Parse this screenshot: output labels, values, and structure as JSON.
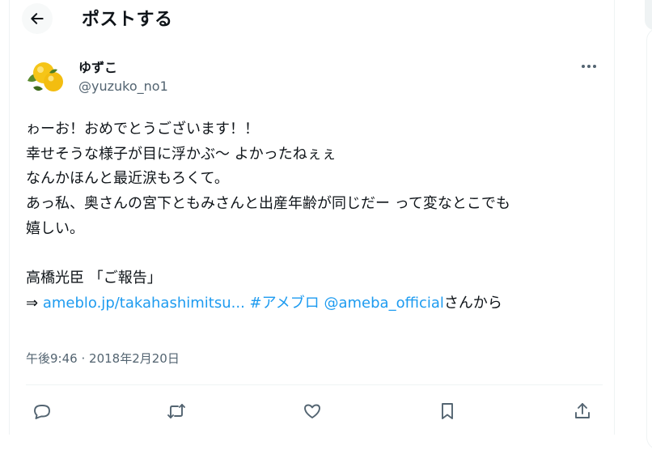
{
  "header": {
    "title": "ポストする"
  },
  "tweet": {
    "display_name": "ゆずこ",
    "handle": "@yuzuko_no1",
    "lines": [
      "ゎーお！おめでとうございます！！",
      "幸せそうな様子が目に浮かぶ〜 よかったねぇぇ",
      "なんかほんと最近涙もろくて。",
      "あっ私、奥さんの宮下ともみさんと出産年齢が同じだー って変なとこでも",
      "嬉しい。",
      "高橋光臣 「ご報告」"
    ],
    "arrow": "⇒",
    "link_url": "ameblo.jp/takahashimitsu...",
    "hashtag": "#アメブロ",
    "mention": "@ameba_official",
    "suffix": "さんから",
    "time": "午後9:46",
    "separator": "·",
    "date": "2018年2月20日"
  },
  "colors": {
    "link": "#1d9bf0",
    "secondary_text": "#536471",
    "text": "#0f1419"
  }
}
